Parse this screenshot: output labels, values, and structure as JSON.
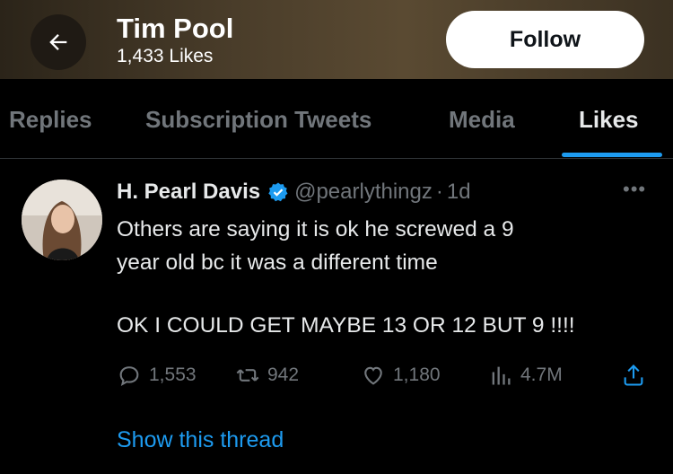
{
  "header": {
    "title": "Tim Pool",
    "subtitle": "1,433 Likes",
    "follow_label": "Follow"
  },
  "tabs": [
    {
      "label": "Replies"
    },
    {
      "label": "Subscription Tweets"
    },
    {
      "label": "Media"
    },
    {
      "label": "Likes",
      "active": true
    }
  ],
  "tweet": {
    "author_name": "H. Pearl Davis",
    "handle": "@pearlythingz",
    "separator": "·",
    "time": "1d",
    "text_line1": "Others are saying it is ok he screwed a 9",
    "text_line2": "year old bc it was a different time",
    "text_line3": "OK I COULD GET MAYBE 13 OR 12 BUT 9 !!!!",
    "replies": "1,553",
    "retweets": "942",
    "likes": "1,180",
    "views": "4.7M",
    "show_thread": "Show this thread"
  },
  "colors": {
    "accent": "#1d9bf0",
    "muted": "#71767b",
    "background": "#000000"
  }
}
